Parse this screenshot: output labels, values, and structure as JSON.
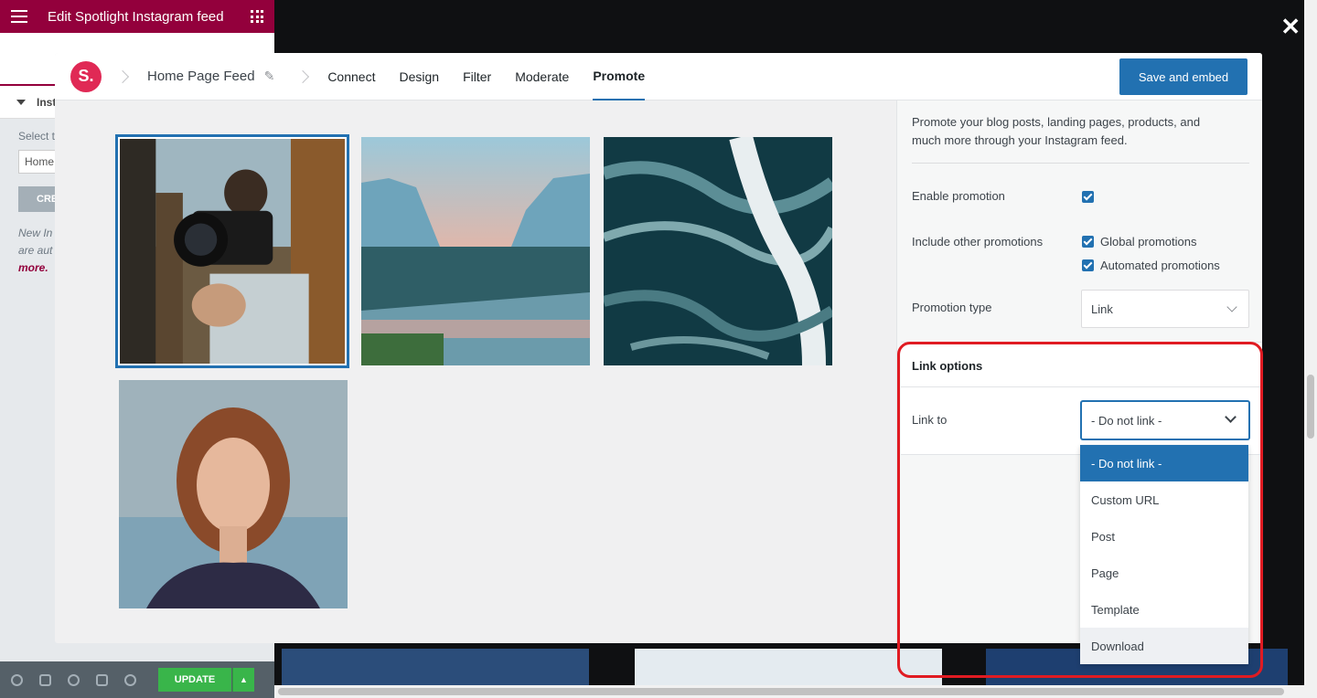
{
  "elementor": {
    "title": "Edit Spotlight Instagram feed",
    "section_label": "Inst",
    "select_label": "Select t",
    "select_value": "Home",
    "create_button": "CRE",
    "note_line1": "New In",
    "note_line2": "are aut",
    "note_link": "more.",
    "update_button": "UPDATE"
  },
  "modal": {
    "close_symbol": "✕",
    "logo_text": "S.",
    "feed_name": "Home Page Feed",
    "tabs": [
      "Connect",
      "Design",
      "Filter",
      "Moderate",
      "Promote"
    ],
    "active_tab": "Promote",
    "save_button": "Save and embed"
  },
  "panel": {
    "description": "Promote your blog posts, landing pages, products, and much more through your Instagram feed.",
    "enable_promotion_label": "Enable promotion",
    "enable_promotion_checked": true,
    "include_other_label": "Include other promotions",
    "global_promotions_label": "Global promotions",
    "global_promotions_checked": true,
    "automated_promotions_label": "Automated promotions",
    "automated_promotions_checked": true,
    "promotion_type_label": "Promotion type",
    "promotion_type_value": "Link",
    "link_options_heading": "Link options",
    "link_to_label": "Link to",
    "link_to_value": "- Do not link -",
    "link_to_options": [
      "- Do not link -",
      "Custom URL",
      "Post",
      "Page",
      "Template",
      "Download"
    ]
  },
  "colors": {
    "accent": "#2271b1",
    "brand_logo": "#e02955",
    "elementor_header": "#93003c",
    "highlight": "#e01b22",
    "update_green": "#39b54a"
  },
  "icons": {
    "menu": "hamburger-icon",
    "apps": "grid-icon",
    "edit": "pencil-icon",
    "close": "close-icon",
    "dropdown": "chevron-down-icon"
  }
}
